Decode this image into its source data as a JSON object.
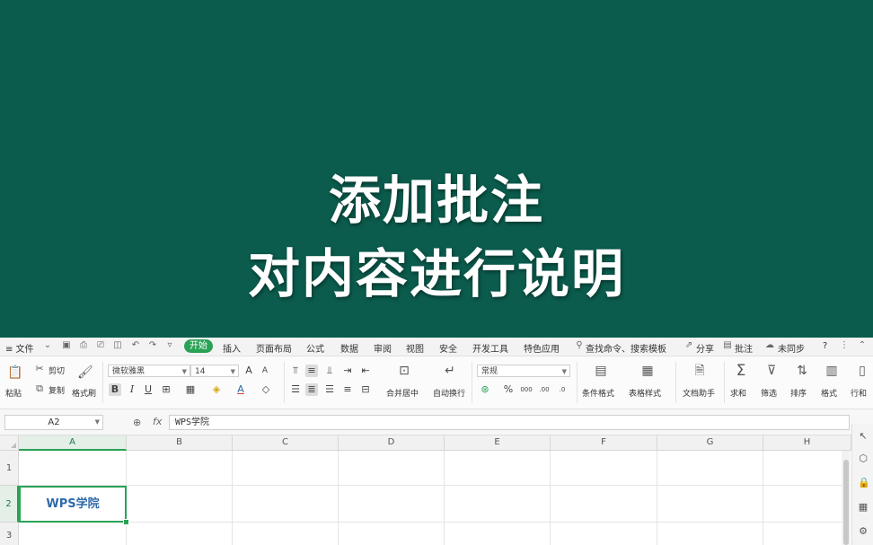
{
  "banner": {
    "line1": "添加批注",
    "line2": "对内容进行说明"
  },
  "menubar": {
    "file": "≡ 文件",
    "tabs": [
      "开始",
      "插入",
      "页面布局",
      "公式",
      "数据",
      "审阅",
      "视图",
      "安全",
      "开发工具",
      "特色应用"
    ],
    "search": "查找命令、搜索模板",
    "share": "分享",
    "comment": "批注",
    "sync": "未同步",
    "help": "?"
  },
  "ribbon": {
    "paste": "粘贴",
    "cut": "剪切",
    "copy": "复制",
    "format_painter": "格式刷",
    "font_name": "微软雅黑",
    "font_size": "14",
    "merge_center": "合并居中",
    "wrap_text": "自动换行",
    "number_format": "常规",
    "conditional_format": "条件格式",
    "table_style": "表格样式",
    "doc_assistant": "文档助手",
    "sum": "求和",
    "filter": "筛选",
    "sort": "排序",
    "format": "格式",
    "row_col": "行和"
  },
  "formula_bar": {
    "cell_ref": "A2",
    "fx": "fx",
    "content": "WPS学院"
  },
  "sheet": {
    "columns": [
      "A",
      "B",
      "C",
      "D",
      "E",
      "F",
      "G",
      "H"
    ],
    "rows": [
      "1",
      "2",
      "3"
    ],
    "cell_A2": "WPS学院"
  },
  "colors": {
    "banner_bg": "#0b5c4d",
    "accent_green": "#2aa256",
    "cell_text": "#2f6aa8"
  }
}
